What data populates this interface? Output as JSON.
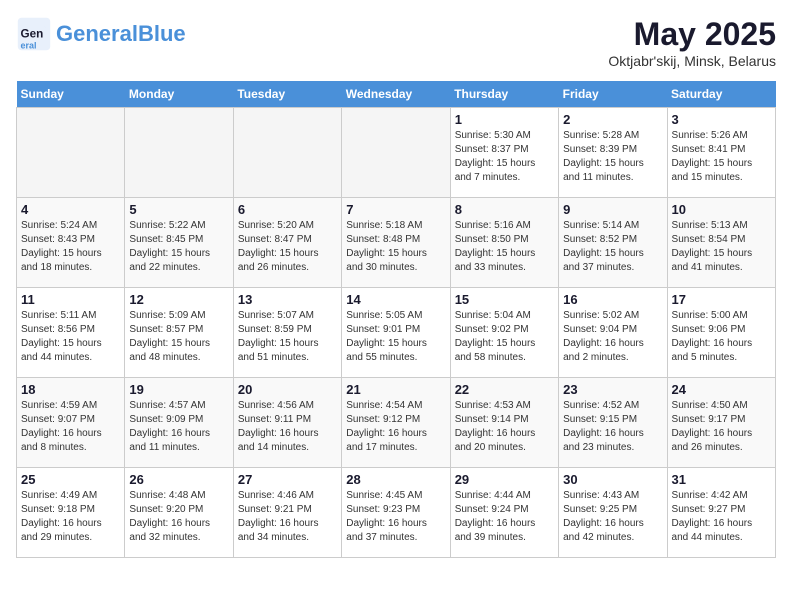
{
  "header": {
    "logo_line1": "General",
    "logo_line2": "Blue",
    "month_title": "May 2025",
    "subtitle": "Oktjabr'skij, Minsk, Belarus"
  },
  "days_of_week": [
    "Sunday",
    "Monday",
    "Tuesday",
    "Wednesday",
    "Thursday",
    "Friday",
    "Saturday"
  ],
  "weeks": [
    [
      {
        "day": "",
        "empty": true
      },
      {
        "day": "",
        "empty": true
      },
      {
        "day": "",
        "empty": true
      },
      {
        "day": "",
        "empty": true
      },
      {
        "day": "1",
        "sunrise": "5:30 AM",
        "sunset": "8:37 PM",
        "daylight": "15 hours and 7 minutes."
      },
      {
        "day": "2",
        "sunrise": "5:28 AM",
        "sunset": "8:39 PM",
        "daylight": "15 hours and 11 minutes."
      },
      {
        "day": "3",
        "sunrise": "5:26 AM",
        "sunset": "8:41 PM",
        "daylight": "15 hours and 15 minutes."
      }
    ],
    [
      {
        "day": "4",
        "sunrise": "5:24 AM",
        "sunset": "8:43 PM",
        "daylight": "15 hours and 18 minutes."
      },
      {
        "day": "5",
        "sunrise": "5:22 AM",
        "sunset": "8:45 PM",
        "daylight": "15 hours and 22 minutes."
      },
      {
        "day": "6",
        "sunrise": "5:20 AM",
        "sunset": "8:47 PM",
        "daylight": "15 hours and 26 minutes."
      },
      {
        "day": "7",
        "sunrise": "5:18 AM",
        "sunset": "8:48 PM",
        "daylight": "15 hours and 30 minutes."
      },
      {
        "day": "8",
        "sunrise": "5:16 AM",
        "sunset": "8:50 PM",
        "daylight": "15 hours and 33 minutes."
      },
      {
        "day": "9",
        "sunrise": "5:14 AM",
        "sunset": "8:52 PM",
        "daylight": "15 hours and 37 minutes."
      },
      {
        "day": "10",
        "sunrise": "5:13 AM",
        "sunset": "8:54 PM",
        "daylight": "15 hours and 41 minutes."
      }
    ],
    [
      {
        "day": "11",
        "sunrise": "5:11 AM",
        "sunset": "8:56 PM",
        "daylight": "15 hours and 44 minutes."
      },
      {
        "day": "12",
        "sunrise": "5:09 AM",
        "sunset": "8:57 PM",
        "daylight": "15 hours and 48 minutes."
      },
      {
        "day": "13",
        "sunrise": "5:07 AM",
        "sunset": "8:59 PM",
        "daylight": "15 hours and 51 minutes."
      },
      {
        "day": "14",
        "sunrise": "5:05 AM",
        "sunset": "9:01 PM",
        "daylight": "15 hours and 55 minutes."
      },
      {
        "day": "15",
        "sunrise": "5:04 AM",
        "sunset": "9:02 PM",
        "daylight": "15 hours and 58 minutes."
      },
      {
        "day": "16",
        "sunrise": "5:02 AM",
        "sunset": "9:04 PM",
        "daylight": "16 hours and 2 minutes."
      },
      {
        "day": "17",
        "sunrise": "5:00 AM",
        "sunset": "9:06 PM",
        "daylight": "16 hours and 5 minutes."
      }
    ],
    [
      {
        "day": "18",
        "sunrise": "4:59 AM",
        "sunset": "9:07 PM",
        "daylight": "16 hours and 8 minutes."
      },
      {
        "day": "19",
        "sunrise": "4:57 AM",
        "sunset": "9:09 PM",
        "daylight": "16 hours and 11 minutes."
      },
      {
        "day": "20",
        "sunrise": "4:56 AM",
        "sunset": "9:11 PM",
        "daylight": "16 hours and 14 minutes."
      },
      {
        "day": "21",
        "sunrise": "4:54 AM",
        "sunset": "9:12 PM",
        "daylight": "16 hours and 17 minutes."
      },
      {
        "day": "22",
        "sunrise": "4:53 AM",
        "sunset": "9:14 PM",
        "daylight": "16 hours and 20 minutes."
      },
      {
        "day": "23",
        "sunrise": "4:52 AM",
        "sunset": "9:15 PM",
        "daylight": "16 hours and 23 minutes."
      },
      {
        "day": "24",
        "sunrise": "4:50 AM",
        "sunset": "9:17 PM",
        "daylight": "16 hours and 26 minutes."
      }
    ],
    [
      {
        "day": "25",
        "sunrise": "4:49 AM",
        "sunset": "9:18 PM",
        "daylight": "16 hours and 29 minutes."
      },
      {
        "day": "26",
        "sunrise": "4:48 AM",
        "sunset": "9:20 PM",
        "daylight": "16 hours and 32 minutes."
      },
      {
        "day": "27",
        "sunrise": "4:46 AM",
        "sunset": "9:21 PM",
        "daylight": "16 hours and 34 minutes."
      },
      {
        "day": "28",
        "sunrise": "4:45 AM",
        "sunset": "9:23 PM",
        "daylight": "16 hours and 37 minutes."
      },
      {
        "day": "29",
        "sunrise": "4:44 AM",
        "sunset": "9:24 PM",
        "daylight": "16 hours and 39 minutes."
      },
      {
        "day": "30",
        "sunrise": "4:43 AM",
        "sunset": "9:25 PM",
        "daylight": "16 hours and 42 minutes."
      },
      {
        "day": "31",
        "sunrise": "4:42 AM",
        "sunset": "9:27 PM",
        "daylight": "16 hours and 44 minutes."
      }
    ]
  ],
  "labels": {
    "sunrise": "Sunrise:",
    "sunset": "Sunset:",
    "daylight": "Daylight:"
  }
}
